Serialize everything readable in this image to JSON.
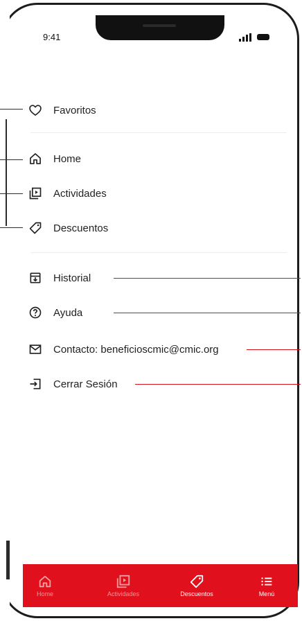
{
  "status_bar": {
    "time": "9:41"
  },
  "menu": {
    "favorites": {
      "label": "Favoritos",
      "icon": "heart-icon"
    },
    "home": {
      "label": "Home",
      "icon": "home-icon"
    },
    "activities": {
      "label": "Actividades",
      "icon": "video-library-icon"
    },
    "discounts": {
      "label": "Descuentos",
      "icon": "tag-icon"
    },
    "history": {
      "label": "Historial",
      "icon": "history-download-icon"
    },
    "help": {
      "label": "Ayuda",
      "icon": "help-circle-icon"
    },
    "contact": {
      "label": "Contacto: beneficioscmic@cmic.org",
      "icon": "mail-icon"
    },
    "logout": {
      "label": "Cerrar Sesión",
      "icon": "logout-icon"
    }
  },
  "tabbar": {
    "tabs": [
      {
        "label": "Home",
        "icon": "home-icon",
        "active": false
      },
      {
        "label": "Actividades",
        "icon": "video-library-icon",
        "active": false
      },
      {
        "label": "Descuentos",
        "icon": "tag-icon",
        "active": true
      },
      {
        "label": "Menú",
        "icon": "menu-list-icon",
        "active": false
      }
    ]
  },
  "colors": {
    "accent": "#e0111c",
    "callout_red": "#d6101b",
    "text": "#222222"
  }
}
